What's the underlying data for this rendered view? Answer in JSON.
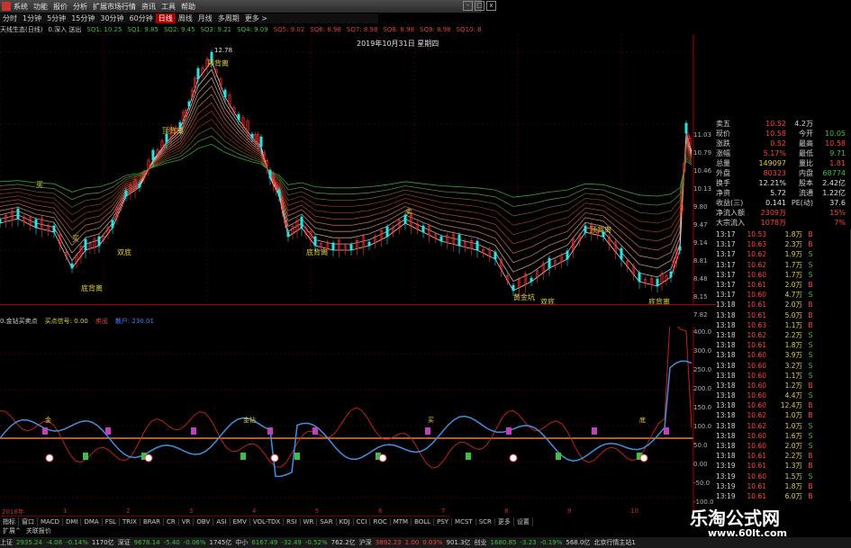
{
  "menu": {
    "items": [
      "系统",
      "功能",
      "报价",
      "分析",
      "扩展市场行情",
      "资讯",
      "工具",
      "帮助"
    ],
    "window_controls": [
      "-",
      "□",
      "x"
    ]
  },
  "periods": [
    "分时",
    "1分钟",
    "5分钟",
    "15分钟",
    "30分钟",
    "60分钟",
    "日线",
    "周线",
    "月线",
    "多周期",
    "更多 >"
  ],
  "active_period_index": 6,
  "indicator_line": [
    {
      "text": "天线生态(日线)",
      "color": "#d0d0d0"
    },
    {
      "text": "0.深入 送出",
      "color": "#d0d0d0"
    },
    {
      "text": "SQ1: 10.25",
      "color": "#40c040"
    },
    {
      "text": "SQ1: 9.85",
      "color": "#40c040"
    },
    {
      "text": "SQ2: 9.45",
      "color": "#40c040"
    },
    {
      "text": "SQ3: 9.21",
      "color": "#40c040"
    },
    {
      "text": "SQ4: 9.09",
      "color": "#40c040"
    },
    {
      "text": "SQ5: 9.02",
      "color": "#e04040"
    },
    {
      "text": "SQ6: 8.98",
      "color": "#e04040"
    },
    {
      "text": "SQ7: 8.98",
      "color": "#e04040"
    },
    {
      "text": "SQ8: 8.98",
      "color": "#e04040"
    },
    {
      "text": "SQ9: 8.98",
      "color": "#e04040"
    },
    {
      "text": "SQ10: 8.98",
      "color": "#e04040"
    }
  ],
  "main_chart": {
    "date_label": "2019年10月31日 星期四",
    "high_label": "12.78",
    "y_labels": [
      "11.03",
      "10.79",
      "10.46",
      "10.13",
      "9.80",
      "9.47",
      "9.14",
      "8.81",
      "8.48",
      "8.15",
      "7.82"
    ],
    "annotations": [
      "买",
      "卖",
      "底背离",
      "双底",
      "顶背离",
      "黄金坑",
      "涨停"
    ]
  },
  "sub_chart": {
    "title_items": [
      {
        "text": "0.金钻买卖点",
        "color": "#d0d0d0"
      },
      {
        "text": "买点信号: 0.00",
        "color": "#e0d040"
      },
      {
        "text": "卖出",
        "color": "#e04040"
      },
      {
        "text": "散户: 230.01",
        "color": "#4080ff"
      }
    ],
    "y_labels": [
      "400.0",
      "300.0",
      "250.0",
      "200.0",
      "150.0",
      "100.0",
      "50.0",
      "0.00",
      "-50.0",
      "-100.0"
    ],
    "marker_labels": [
      "金",
      "金钻",
      "买",
      "底"
    ]
  },
  "bottom_tabs": [
    "2018年",
    "1",
    "2",
    "3",
    "4",
    "5",
    "6",
    "7",
    "8",
    "9",
    "10"
  ],
  "indicator_tabs": [
    "指标",
    "窗口",
    "MACD",
    "DMI",
    "DMA",
    "FSL",
    "TRIX",
    "BRAR",
    "CR",
    "VR",
    "OBV",
    "ASI",
    "EMV",
    "VOL-TDX",
    "RSI",
    "WR",
    "SAR",
    "KDJ",
    "CCI",
    "ROC",
    "MTM",
    "BOLL",
    "PSY",
    "MCST",
    "SCR",
    "更多",
    "设置"
  ],
  "bottom_tabs2": [
    "扩展^",
    "关联报价"
  ],
  "quote_panel": {
    "rows": [
      {
        "c1": "卖五",
        "c2": "10.52",
        "c3": "4.2万",
        "c4": "",
        "c2color": "#ff4040"
      },
      {
        "c1": "现价",
        "c2": "10.58",
        "c3": "今开",
        "c4": "10.05",
        "c2color": "#ff4040",
        "c4color": "#40c040"
      },
      {
        "c1": "涨跌",
        "c2": "0.52",
        "c3": "最高",
        "c4": "10.58",
        "c2color": "#ff4040",
        "c4color": "#ff4040"
      },
      {
        "c1": "涨幅",
        "c2": "5.17%",
        "c3": "最低",
        "c4": "9.71",
        "c2color": "#ff4040",
        "c4color": "#40c040"
      },
      {
        "c1": "总量",
        "c2": "149097",
        "c3": "量比",
        "c4": "1.81",
        "c2color": "#e0d040",
        "c4color": "#ff4040"
      },
      {
        "c1": "外盘",
        "c2": "80323",
        "c3": "内盘",
        "c4": "68774",
        "c2color": "#ff4040",
        "c4color": "#40c040"
      },
      {
        "c1": "换手",
        "c2": "12.21%",
        "c3": "股本",
        "c4": "2.42亿",
        "c2color": "#e0e0e0",
        "c4color": "#e0e0e0"
      },
      {
        "c1": "净资",
        "c2": "5.72",
        "c3": "流通",
        "c4": "1.22亿",
        "c2color": "#e0e0e0",
        "c4color": "#e0e0e0"
      },
      {
        "c1": "收益(三)",
        "c2": "0.141",
        "c3": "PE(动)",
        "c4": "37.6",
        "c2color": "#e0e0e0",
        "c4color": "#e0e0e0"
      },
      {
        "c1": "净流入额",
        "c2": "2309万",
        "c3": "",
        "c4": "15%",
        "c2color": "#ff4040",
        "c4color": "#ff4040"
      },
      {
        "c1": "大宗流入",
        "c2": "1078万",
        "c3": "",
        "c4": "7%",
        "c2color": "#ff4040",
        "c4color": "#ff4040"
      }
    ],
    "ticks": [
      {
        "t": "13:17",
        "p": "10.53",
        "v": "1.8万",
        "s": "B",
        "sc": "#ff4040"
      },
      {
        "t": "13:17",
        "p": "10.63",
        "v": "2.3万",
        "s": "B",
        "sc": "#ff4040"
      },
      {
        "t": "13:17",
        "p": "10.62",
        "v": "1.9万",
        "s": "S",
        "sc": "#40c040"
      },
      {
        "t": "13:17",
        "p": "10.62",
        "v": "1.7万",
        "s": "S",
        "sc": "#40c040"
      },
      {
        "t": "13:17",
        "p": "10.60",
        "v": "1.7万",
        "s": "S",
        "sc": "#40c040"
      },
      {
        "t": "13:17",
        "p": "10.61",
        "v": "2.0万",
        "s": "B",
        "sc": "#ff4040"
      },
      {
        "t": "13:17",
        "p": "10.60",
        "v": "4.7万",
        "s": "S",
        "sc": "#40c040"
      },
      {
        "t": "13:18",
        "p": "10.61",
        "v": "2.0万",
        "s": "B",
        "sc": "#ff4040"
      },
      {
        "t": "13:18",
        "p": "10.61",
        "v": "5.0万",
        "s": "B",
        "sc": "#ff4040"
      },
      {
        "t": "13:18",
        "p": "10.63",
        "v": "1.1万",
        "s": "B",
        "sc": "#ff4040"
      },
      {
        "t": "13:18",
        "p": "10.62",
        "v": "2.2万",
        "s": "S",
        "sc": "#40c040"
      },
      {
        "t": "13:18",
        "p": "10.61",
        "v": "1.8万",
        "s": "S",
        "sc": "#40c040"
      },
      {
        "t": "13:18",
        "p": "10.60",
        "v": "3.9万",
        "s": "S",
        "sc": "#40c040"
      },
      {
        "t": "13:18",
        "p": "10.60",
        "v": "3.2万",
        "s": "S",
        "sc": "#40c040"
      },
      {
        "t": "13:18",
        "p": "10.60",
        "v": "1.1万",
        "s": "S",
        "sc": "#40c040"
      },
      {
        "t": "13:18",
        "p": "10.60",
        "v": "1.2万",
        "s": "B",
        "sc": "#ff4040"
      },
      {
        "t": "13:18",
        "p": "10.60",
        "v": "4.4万",
        "s": "S",
        "sc": "#40c040"
      },
      {
        "t": "13:18",
        "p": "10.60",
        "v": "12.4万",
        "s": "B",
        "sc": "#ff4040"
      },
      {
        "t": "13:18",
        "p": "10.62",
        "v": "1.0万",
        "s": "B",
        "sc": "#ff4040"
      },
      {
        "t": "13:18",
        "p": "10.62",
        "v": "1.0万",
        "s": "S",
        "sc": "#40c040"
      },
      {
        "t": "13:18",
        "p": "10.60",
        "v": "1.6万",
        "s": "S",
        "sc": "#40c040"
      },
      {
        "t": "13:18",
        "p": "10.60",
        "v": "2.0万",
        "s": "S",
        "sc": "#40c040"
      },
      {
        "t": "13:18",
        "p": "10.61",
        "v": "2.2万",
        "s": "B",
        "sc": "#ff4040"
      },
      {
        "t": "13:19",
        "p": "10.61",
        "v": "1.3万",
        "s": "B",
        "sc": "#ff4040"
      },
      {
        "t": "13:19",
        "p": "10.60",
        "v": "1.5万",
        "s": "S",
        "sc": "#40c040"
      },
      {
        "t": "13:19",
        "p": "10.61",
        "v": "1.8万",
        "s": "B",
        "sc": "#ff4040"
      },
      {
        "t": "13:19",
        "p": "10.61",
        "v": "6.0万",
        "s": "B",
        "sc": "#ff4040"
      }
    ]
  },
  "status_bar": [
    {
      "text": "上证",
      "color": "#d0d0d0"
    },
    {
      "text": "2935.24",
      "color": "#40c040"
    },
    {
      "text": "-4.08",
      "color": "#40c040"
    },
    {
      "text": "-0.14%",
      "color": "#40c040"
    },
    {
      "text": "1170亿",
      "color": "#d0d0d0"
    },
    {
      "text": "深证",
      "color": "#d0d0d0"
    },
    {
      "text": "9678.14",
      "color": "#40c040"
    },
    {
      "text": "-5.40",
      "color": "#40c040"
    },
    {
      "text": "-0.06%",
      "color": "#40c040"
    },
    {
      "text": "1745亿",
      "color": "#d0d0d0"
    },
    {
      "text": "中小",
      "color": "#d0d0d0"
    },
    {
      "text": "6167.49",
      "color": "#40c040"
    },
    {
      "text": "-32.49",
      "color": "#40c040"
    },
    {
      "text": "-0.52%",
      "color": "#40c040"
    },
    {
      "text": "762.2亿",
      "color": "#d0d0d0"
    },
    {
      "text": "沪深",
      "color": "#d0d0d0"
    },
    {
      "text": "3892.23",
      "color": "#ff4040"
    },
    {
      "text": "1.00",
      "color": "#ff4040"
    },
    {
      "text": "0.03%",
      "color": "#ff4040"
    },
    {
      "text": "901.3亿",
      "color": "#d0d0d0"
    },
    {
      "text": "创业",
      "color": "#d0d0d0"
    },
    {
      "text": "1680.85",
      "color": "#40c040"
    },
    {
      "text": "-3.23",
      "color": "#40c040"
    },
    {
      "text": "-0.19%",
      "color": "#40c040"
    },
    {
      "text": "568.0亿",
      "color": "#d0d0d0"
    },
    {
      "text": "北京行情主站1",
      "color": "#d0d0d0"
    }
  ],
  "watermark": {
    "title": "乐淘公式网",
    "url": "www.60lt.com"
  }
}
